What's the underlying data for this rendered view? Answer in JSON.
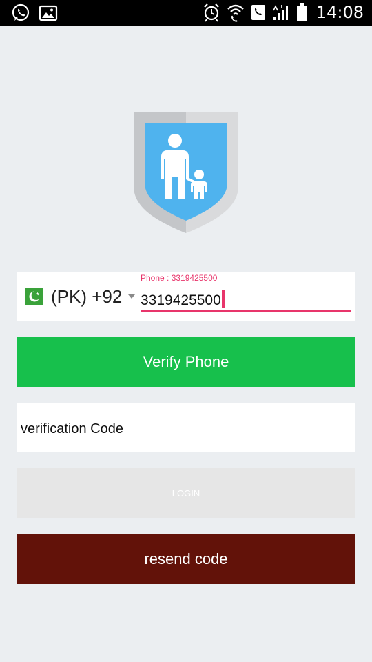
{
  "status_bar": {
    "time": "14:08",
    "left_icons": [
      "whatsapp-icon",
      "gallery-icon"
    ],
    "right_icons": [
      "alarm-icon",
      "wifi-calling-icon",
      "call-icon",
      "signal-icon",
      "battery-icon"
    ]
  },
  "logo": {
    "icon": "parent-child-shield-icon"
  },
  "phone": {
    "country_code": "(PK) +92",
    "flag_icon": "pakistan-flag-icon",
    "floating_label": "Phone : 3319425500",
    "value": "3319425500"
  },
  "buttons": {
    "verify_label": "Verify Phone",
    "login_label": "LOGIN",
    "resend_label": "resend code"
  },
  "verification": {
    "placeholder": "verification Code"
  },
  "colors": {
    "background": "#ebeef1",
    "accent_pink": "#e8356b",
    "verify_green": "#17c04c",
    "login_disabled": "#e6e6e6",
    "resend_maroon": "#621209",
    "shield_blue": "#4fb3ee"
  }
}
